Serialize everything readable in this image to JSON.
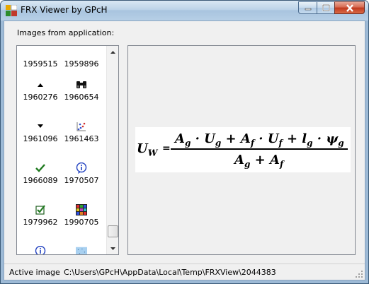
{
  "window": {
    "title": "FRX Viewer by GPcH"
  },
  "main": {
    "images_label": "Images from application:",
    "items": [
      {
        "label": "1959515",
        "icon": "none"
      },
      {
        "label": "1959896",
        "icon": "none"
      },
      {
        "label": "1960276",
        "icon": "up-arrow-icon"
      },
      {
        "label": "1960654",
        "icon": "binoculars-icon"
      },
      {
        "label": "1961096",
        "icon": "down-arrow-icon"
      },
      {
        "label": "1961463",
        "icon": "scatter-icon"
      },
      {
        "label": "1966089",
        "icon": "checkmark-icon"
      },
      {
        "label": "1970507",
        "icon": "info-icon"
      },
      {
        "label": "1979962",
        "icon": "checkbox-icon"
      },
      {
        "label": "1990705",
        "icon": "grid-icon"
      },
      {
        "label": "",
        "icon": "info-icon"
      },
      {
        "label": "",
        "icon": "dotted-blue-icon"
      }
    ],
    "formula": {
      "lhs": "U",
      "lhs_sub": "W",
      "eq": "=",
      "num": [
        "A",
        "g",
        " · U",
        "g",
        " + A",
        "f",
        " · U",
        "f",
        " + l",
        "g",
        " · ψ",
        "g"
      ],
      "den": [
        "A",
        "g",
        " + A",
        "f"
      ]
    }
  },
  "statusbar": {
    "label": "Active image",
    "path": "C:\\Users\\GPcH\\AppData\\Local\\Temp\\FRXView\\2044383"
  }
}
